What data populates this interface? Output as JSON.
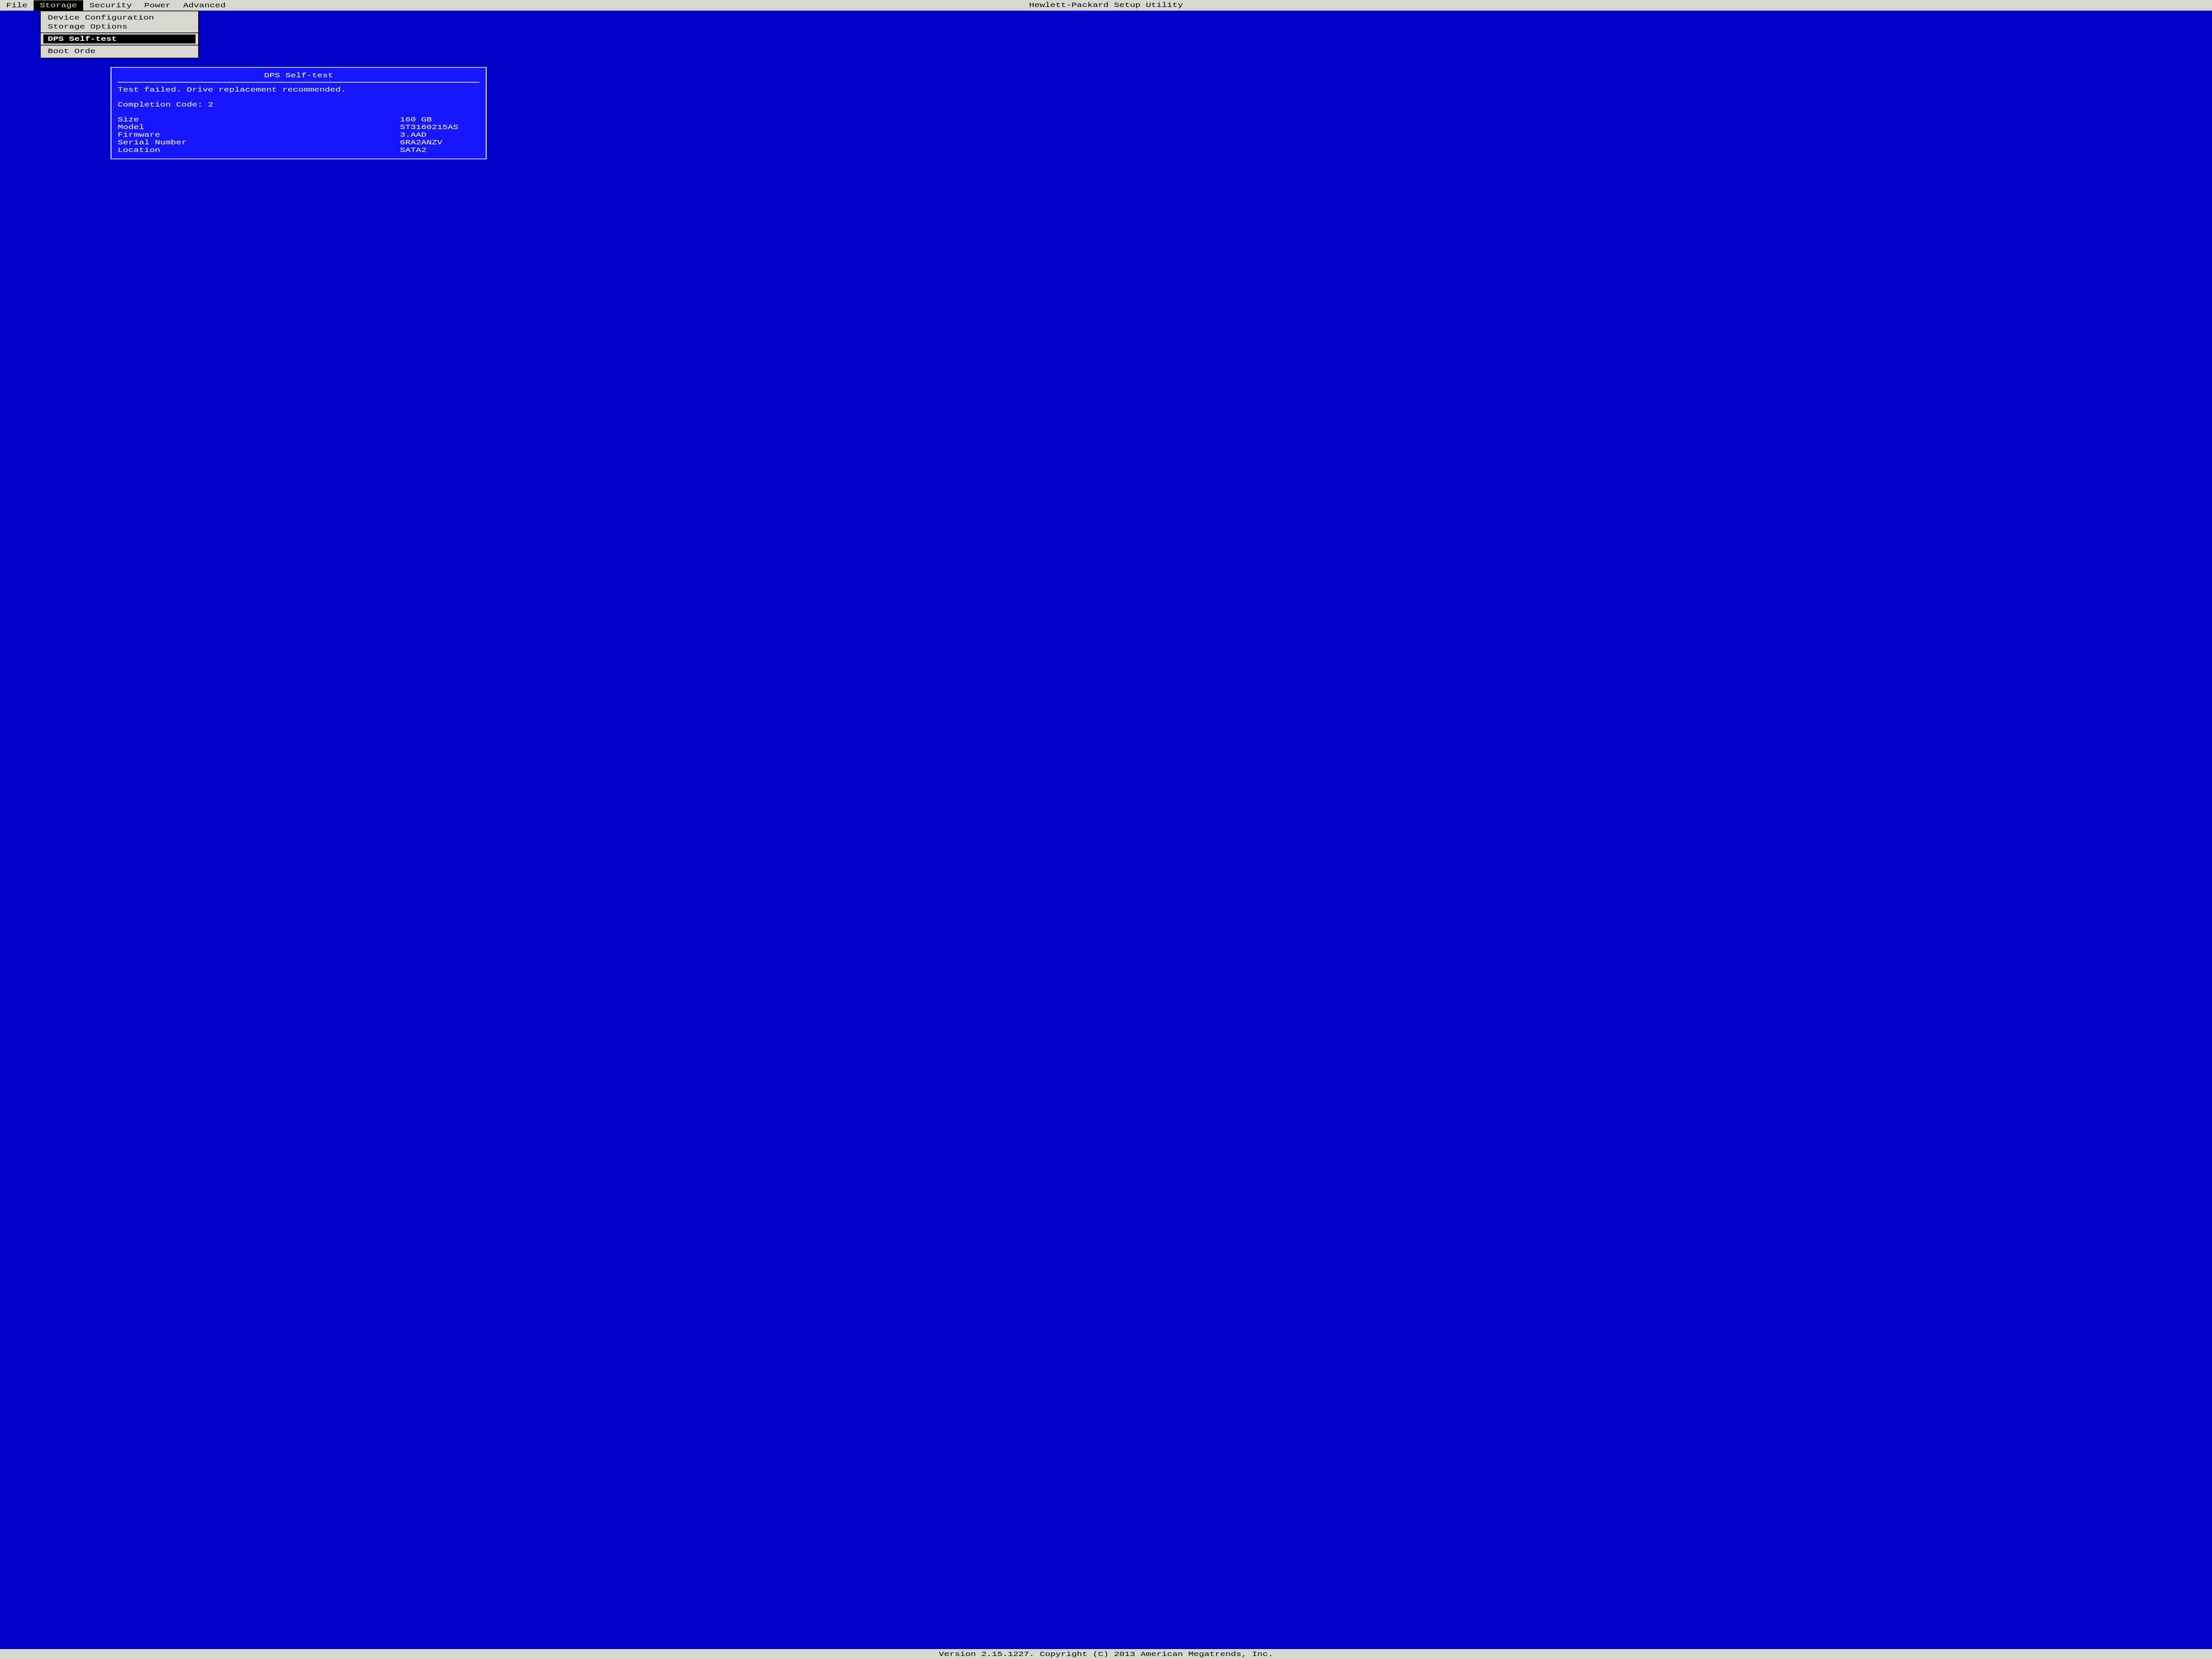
{
  "title": "Hewlett-Packard Setup Utility",
  "menubar": {
    "items": [
      {
        "label": "File",
        "selected": false
      },
      {
        "label": "Storage",
        "selected": true
      },
      {
        "label": "Security",
        "selected": false
      },
      {
        "label": "Power",
        "selected": false
      },
      {
        "label": "Advanced",
        "selected": false
      }
    ]
  },
  "dropdown": {
    "items": [
      {
        "label": "Device Configuration",
        "selected": false,
        "divider_after": false
      },
      {
        "label": "Storage Options",
        "selected": false,
        "divider_after": true
      },
      {
        "label": "DPS Self-test",
        "selected": true,
        "divider_after": true
      },
      {
        "label": "Boot Orde",
        "selected": false,
        "divider_after": false
      }
    ]
  },
  "dialog": {
    "title": "DPS Self-test",
    "status_line": "Test failed.  Drive replacement recommended.",
    "completion_line": "Completion Code: 2",
    "info": [
      {
        "label": "Size",
        "value": "160 GB"
      },
      {
        "label": "Model",
        "value": "ST3160215AS"
      },
      {
        "label": "Firmware",
        "value": "3.AAD"
      },
      {
        "label": "Serial Number",
        "value": "6RA2ANZV"
      },
      {
        "label": "Location",
        "value": "SATA2"
      }
    ]
  },
  "footer": "Version 2.15.1227. Copyright (C) 2013 American Megatrends, Inc."
}
